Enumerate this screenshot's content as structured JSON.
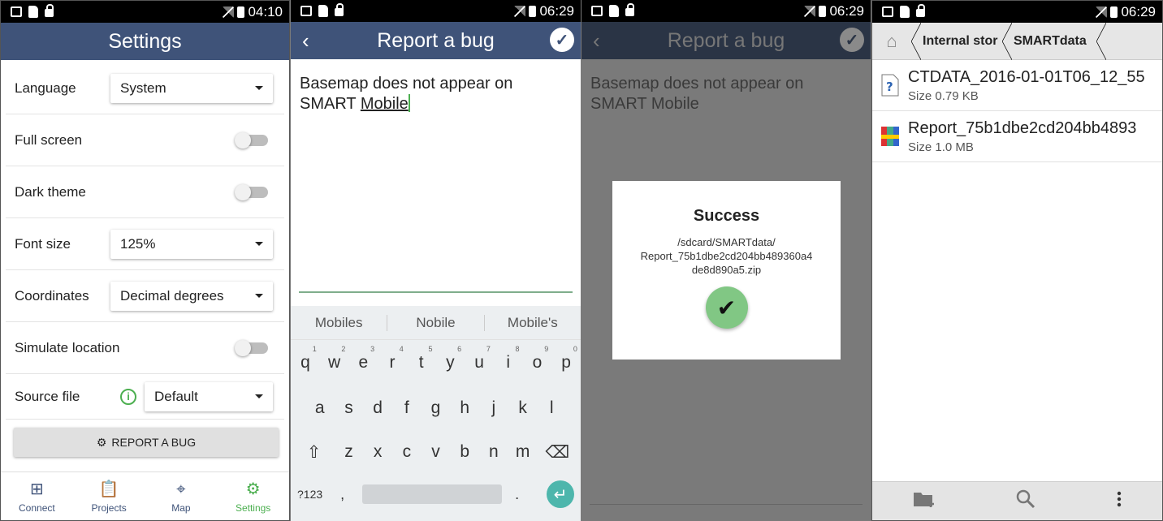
{
  "status_times": [
    "04:10",
    "06:29",
    "06:29",
    "06:29"
  ],
  "settings": {
    "title": "Settings",
    "rows": [
      {
        "label": "Language",
        "type": "dropdown",
        "value": "System"
      },
      {
        "label": "Full screen",
        "type": "toggle",
        "on": false
      },
      {
        "label": "Dark theme",
        "type": "toggle",
        "on": false
      },
      {
        "label": "Font size",
        "type": "dropdown",
        "value": "125%"
      },
      {
        "label": "Coordinates",
        "type": "dropdown",
        "value": "Decimal degrees"
      },
      {
        "label": "Simulate location",
        "type": "toggle",
        "on": false
      },
      {
        "label": "Source file",
        "type": "dropdown",
        "value": "Default",
        "info": true
      }
    ],
    "report_button": "REPORT A BUG",
    "nav": [
      {
        "label": "Connect",
        "icon": "grid-icon"
      },
      {
        "label": "Projects",
        "icon": "clipboard-icon"
      },
      {
        "label": "Map",
        "icon": "map-pin-icon"
      },
      {
        "label": "Settings",
        "icon": "gear-icon",
        "active": true
      }
    ]
  },
  "report": {
    "title": "Report a bug",
    "text_before": "Basemap does not appear on SMART ",
    "text_current_word": "Mobile",
    "suggestions": [
      "Mobiles",
      "Nobile",
      "Mobile's"
    ],
    "keys_row1": [
      [
        "q",
        "1"
      ],
      [
        "w",
        "2"
      ],
      [
        "e",
        "3"
      ],
      [
        "r",
        "4"
      ],
      [
        "t",
        "5"
      ],
      [
        "y",
        "6"
      ],
      [
        "u",
        "7"
      ],
      [
        "i",
        "8"
      ],
      [
        "o",
        "9"
      ],
      [
        "p",
        "0"
      ]
    ],
    "keys_row2": [
      "a",
      "s",
      "d",
      "f",
      "g",
      "h",
      "j",
      "k",
      "l"
    ],
    "keys_row3": [
      "z",
      "x",
      "c",
      "v",
      "b",
      "n",
      "m"
    ],
    "sym_key": "?123",
    "comma_key": ",",
    "period_key": "."
  },
  "dialog": {
    "title": "Success",
    "path_lines": [
      "/sdcard/SMARTdata/",
      "Report_75b1dbe2cd204bb489360a4",
      "de8d890a5.zip"
    ]
  },
  "files": {
    "crumbs": [
      "Internal stor",
      "SMARTdata"
    ],
    "items": [
      {
        "name": "CTDATA_2016-01-01T06_12_55",
        "size": "Size 0.79 KB",
        "icon": "unknown-file-icon"
      },
      {
        "name": "Report_75b1dbe2cd204bb4893",
        "size": "Size 1.0 MB",
        "icon": "archive-file-icon"
      }
    ]
  },
  "colors": {
    "appbar": "#3f5379",
    "accent": "#4caf50",
    "enter": "#4db6ac"
  }
}
